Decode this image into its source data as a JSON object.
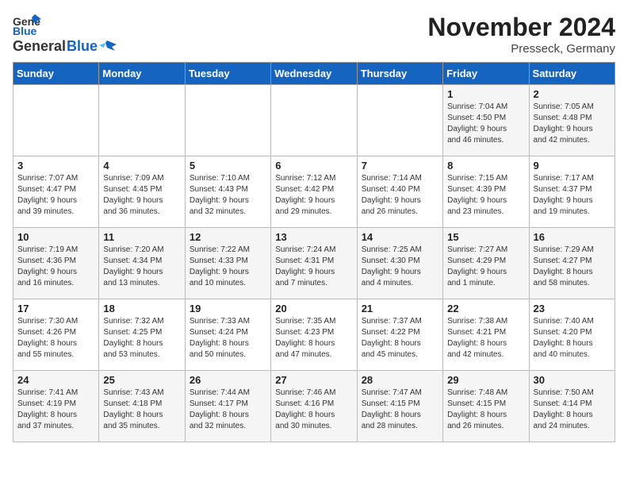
{
  "header": {
    "logo_general": "General",
    "logo_blue": "Blue",
    "month_title": "November 2024",
    "location": "Presseck, Germany"
  },
  "days_of_week": [
    "Sunday",
    "Monday",
    "Tuesday",
    "Wednesday",
    "Thursday",
    "Friday",
    "Saturday"
  ],
  "weeks": [
    [
      {
        "day": "",
        "info": ""
      },
      {
        "day": "",
        "info": ""
      },
      {
        "day": "",
        "info": ""
      },
      {
        "day": "",
        "info": ""
      },
      {
        "day": "",
        "info": ""
      },
      {
        "day": "1",
        "info": "Sunrise: 7:04 AM\nSunset: 4:50 PM\nDaylight: 9 hours\nand 46 minutes."
      },
      {
        "day": "2",
        "info": "Sunrise: 7:05 AM\nSunset: 4:48 PM\nDaylight: 9 hours\nand 42 minutes."
      }
    ],
    [
      {
        "day": "3",
        "info": "Sunrise: 7:07 AM\nSunset: 4:47 PM\nDaylight: 9 hours\nand 39 minutes."
      },
      {
        "day": "4",
        "info": "Sunrise: 7:09 AM\nSunset: 4:45 PM\nDaylight: 9 hours\nand 36 minutes."
      },
      {
        "day": "5",
        "info": "Sunrise: 7:10 AM\nSunset: 4:43 PM\nDaylight: 9 hours\nand 32 minutes."
      },
      {
        "day": "6",
        "info": "Sunrise: 7:12 AM\nSunset: 4:42 PM\nDaylight: 9 hours\nand 29 minutes."
      },
      {
        "day": "7",
        "info": "Sunrise: 7:14 AM\nSunset: 4:40 PM\nDaylight: 9 hours\nand 26 minutes."
      },
      {
        "day": "8",
        "info": "Sunrise: 7:15 AM\nSunset: 4:39 PM\nDaylight: 9 hours\nand 23 minutes."
      },
      {
        "day": "9",
        "info": "Sunrise: 7:17 AM\nSunset: 4:37 PM\nDaylight: 9 hours\nand 19 minutes."
      }
    ],
    [
      {
        "day": "10",
        "info": "Sunrise: 7:19 AM\nSunset: 4:36 PM\nDaylight: 9 hours\nand 16 minutes."
      },
      {
        "day": "11",
        "info": "Sunrise: 7:20 AM\nSunset: 4:34 PM\nDaylight: 9 hours\nand 13 minutes."
      },
      {
        "day": "12",
        "info": "Sunrise: 7:22 AM\nSunset: 4:33 PM\nDaylight: 9 hours\nand 10 minutes."
      },
      {
        "day": "13",
        "info": "Sunrise: 7:24 AM\nSunset: 4:31 PM\nDaylight: 9 hours\nand 7 minutes."
      },
      {
        "day": "14",
        "info": "Sunrise: 7:25 AM\nSunset: 4:30 PM\nDaylight: 9 hours\nand 4 minutes."
      },
      {
        "day": "15",
        "info": "Sunrise: 7:27 AM\nSunset: 4:29 PM\nDaylight: 9 hours\nand 1 minute."
      },
      {
        "day": "16",
        "info": "Sunrise: 7:29 AM\nSunset: 4:27 PM\nDaylight: 8 hours\nand 58 minutes."
      }
    ],
    [
      {
        "day": "17",
        "info": "Sunrise: 7:30 AM\nSunset: 4:26 PM\nDaylight: 8 hours\nand 55 minutes."
      },
      {
        "day": "18",
        "info": "Sunrise: 7:32 AM\nSunset: 4:25 PM\nDaylight: 8 hours\nand 53 minutes."
      },
      {
        "day": "19",
        "info": "Sunrise: 7:33 AM\nSunset: 4:24 PM\nDaylight: 8 hours\nand 50 minutes."
      },
      {
        "day": "20",
        "info": "Sunrise: 7:35 AM\nSunset: 4:23 PM\nDaylight: 8 hours\nand 47 minutes."
      },
      {
        "day": "21",
        "info": "Sunrise: 7:37 AM\nSunset: 4:22 PM\nDaylight: 8 hours\nand 45 minutes."
      },
      {
        "day": "22",
        "info": "Sunrise: 7:38 AM\nSunset: 4:21 PM\nDaylight: 8 hours\nand 42 minutes."
      },
      {
        "day": "23",
        "info": "Sunrise: 7:40 AM\nSunset: 4:20 PM\nDaylight: 8 hours\nand 40 minutes."
      }
    ],
    [
      {
        "day": "24",
        "info": "Sunrise: 7:41 AM\nSunset: 4:19 PM\nDaylight: 8 hours\nand 37 minutes."
      },
      {
        "day": "25",
        "info": "Sunrise: 7:43 AM\nSunset: 4:18 PM\nDaylight: 8 hours\nand 35 minutes."
      },
      {
        "day": "26",
        "info": "Sunrise: 7:44 AM\nSunset: 4:17 PM\nDaylight: 8 hours\nand 32 minutes."
      },
      {
        "day": "27",
        "info": "Sunrise: 7:46 AM\nSunset: 4:16 PM\nDaylight: 8 hours\nand 30 minutes."
      },
      {
        "day": "28",
        "info": "Sunrise: 7:47 AM\nSunset: 4:15 PM\nDaylight: 8 hours\nand 28 minutes."
      },
      {
        "day": "29",
        "info": "Sunrise: 7:48 AM\nSunset: 4:15 PM\nDaylight: 8 hours\nand 26 minutes."
      },
      {
        "day": "30",
        "info": "Sunrise: 7:50 AM\nSunset: 4:14 PM\nDaylight: 8 hours\nand 24 minutes."
      }
    ]
  ]
}
